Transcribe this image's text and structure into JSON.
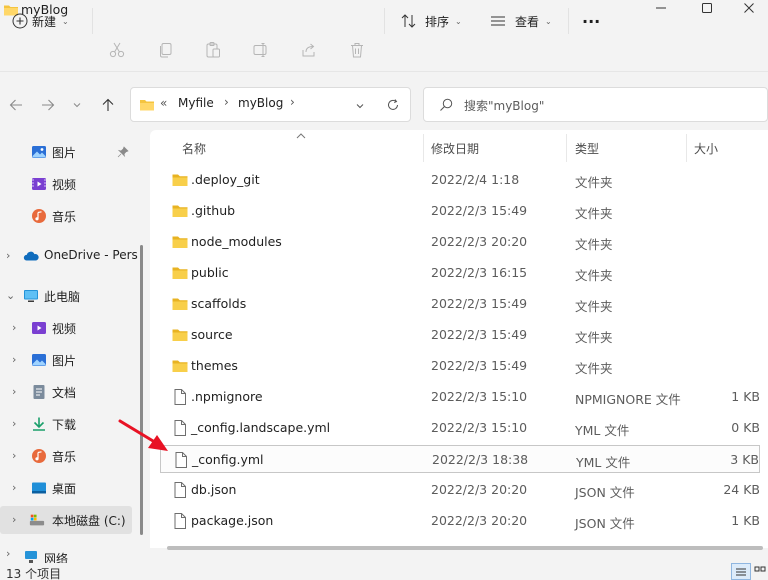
{
  "window": {
    "title": "myBlog",
    "icons": {
      "app": "folder-icon",
      "minimize": "minimize-icon",
      "maximize": "maximize-icon",
      "close": "close-icon"
    }
  },
  "toolbar": {
    "new_label": "新建",
    "sort_label": "排序",
    "view_label": "查看",
    "more_label": "···",
    "icons": [
      "plus-circle-icon",
      "cut-icon",
      "copy-icon",
      "paste-icon",
      "rename-icon",
      "share-icon",
      "delete-icon",
      "sort-icon",
      "view-icon",
      "more-icon"
    ]
  },
  "address": {
    "prefix": "«",
    "crumbs": [
      "Myfile",
      "myBlog"
    ],
    "separator": "›"
  },
  "search": {
    "placeholder": "搜索\"myBlog\""
  },
  "sidebar": {
    "items": [
      {
        "label": "图片",
        "icon": "pictures-icon",
        "pinned": true
      },
      {
        "label": "视频",
        "icon": "videos-icon"
      },
      {
        "label": "音乐",
        "icon": "music-icon"
      },
      {
        "label": "OneDrive - Pers",
        "icon": "onedrive-icon",
        "expandable": true
      },
      {
        "label": "此电脑",
        "icon": "this-pc-icon",
        "expanded": true
      },
      {
        "label": "视频",
        "icon": "videos-icon",
        "expandable": true
      },
      {
        "label": "图片",
        "icon": "pictures-icon",
        "expandable": true
      },
      {
        "label": "文档",
        "icon": "documents-icon",
        "expandable": true
      },
      {
        "label": "下载",
        "icon": "downloads-icon",
        "expandable": true
      },
      {
        "label": "音乐",
        "icon": "music-icon",
        "expandable": true
      },
      {
        "label": "桌面",
        "icon": "desktop-icon",
        "expandable": true
      },
      {
        "label": "本地磁盘 (C:)",
        "icon": "drive-icon",
        "expandable": true,
        "selected": true
      },
      {
        "label": "网络",
        "icon": "network-icon",
        "expandable": true
      }
    ]
  },
  "columns": {
    "name": "名称",
    "modified": "修改日期",
    "type": "类型",
    "size": "大小"
  },
  "files": [
    {
      "name": ".deploy_git",
      "modified": "2022/2/4 1:18",
      "type": "文件夹",
      "size": "",
      "kind": "folder"
    },
    {
      "name": ".github",
      "modified": "2022/2/3 15:49",
      "type": "文件夹",
      "size": "",
      "kind": "folder"
    },
    {
      "name": "node_modules",
      "modified": "2022/2/3 20:20",
      "type": "文件夹",
      "size": "",
      "kind": "folder"
    },
    {
      "name": "public",
      "modified": "2022/2/3 16:15",
      "type": "文件夹",
      "size": "",
      "kind": "folder"
    },
    {
      "name": "scaffolds",
      "modified": "2022/2/3 15:49",
      "type": "文件夹",
      "size": "",
      "kind": "folder"
    },
    {
      "name": "source",
      "modified": "2022/2/3 15:49",
      "type": "文件夹",
      "size": "",
      "kind": "folder"
    },
    {
      "name": "themes",
      "modified": "2022/2/3 15:49",
      "type": "文件夹",
      "size": "",
      "kind": "folder"
    },
    {
      "name": ".npmignore",
      "modified": "2022/2/3 15:10",
      "type": "NPMIGNORE 文件",
      "size": "1 KB",
      "kind": "file"
    },
    {
      "name": "_config.landscape.yml",
      "modified": "2022/2/3 15:10",
      "type": "YML 文件",
      "size": "0 KB",
      "kind": "file"
    },
    {
      "name": "_config.yml",
      "modified": "2022/2/3 18:38",
      "type": "YML 文件",
      "size": "3 KB",
      "kind": "file",
      "highlighted": true
    },
    {
      "name": "db.json",
      "modified": "2022/2/3 20:20",
      "type": "JSON 文件",
      "size": "24 KB",
      "kind": "file"
    },
    {
      "name": "package.json",
      "modified": "2022/2/3 20:20",
      "type": "JSON 文件",
      "size": "1 KB",
      "kind": "file"
    }
  ],
  "status": {
    "item_count": "13 个项目"
  },
  "colors": {
    "folder": "#f4c43f",
    "accent": "#0067c0",
    "annotation_arrow": "#e81224"
  }
}
